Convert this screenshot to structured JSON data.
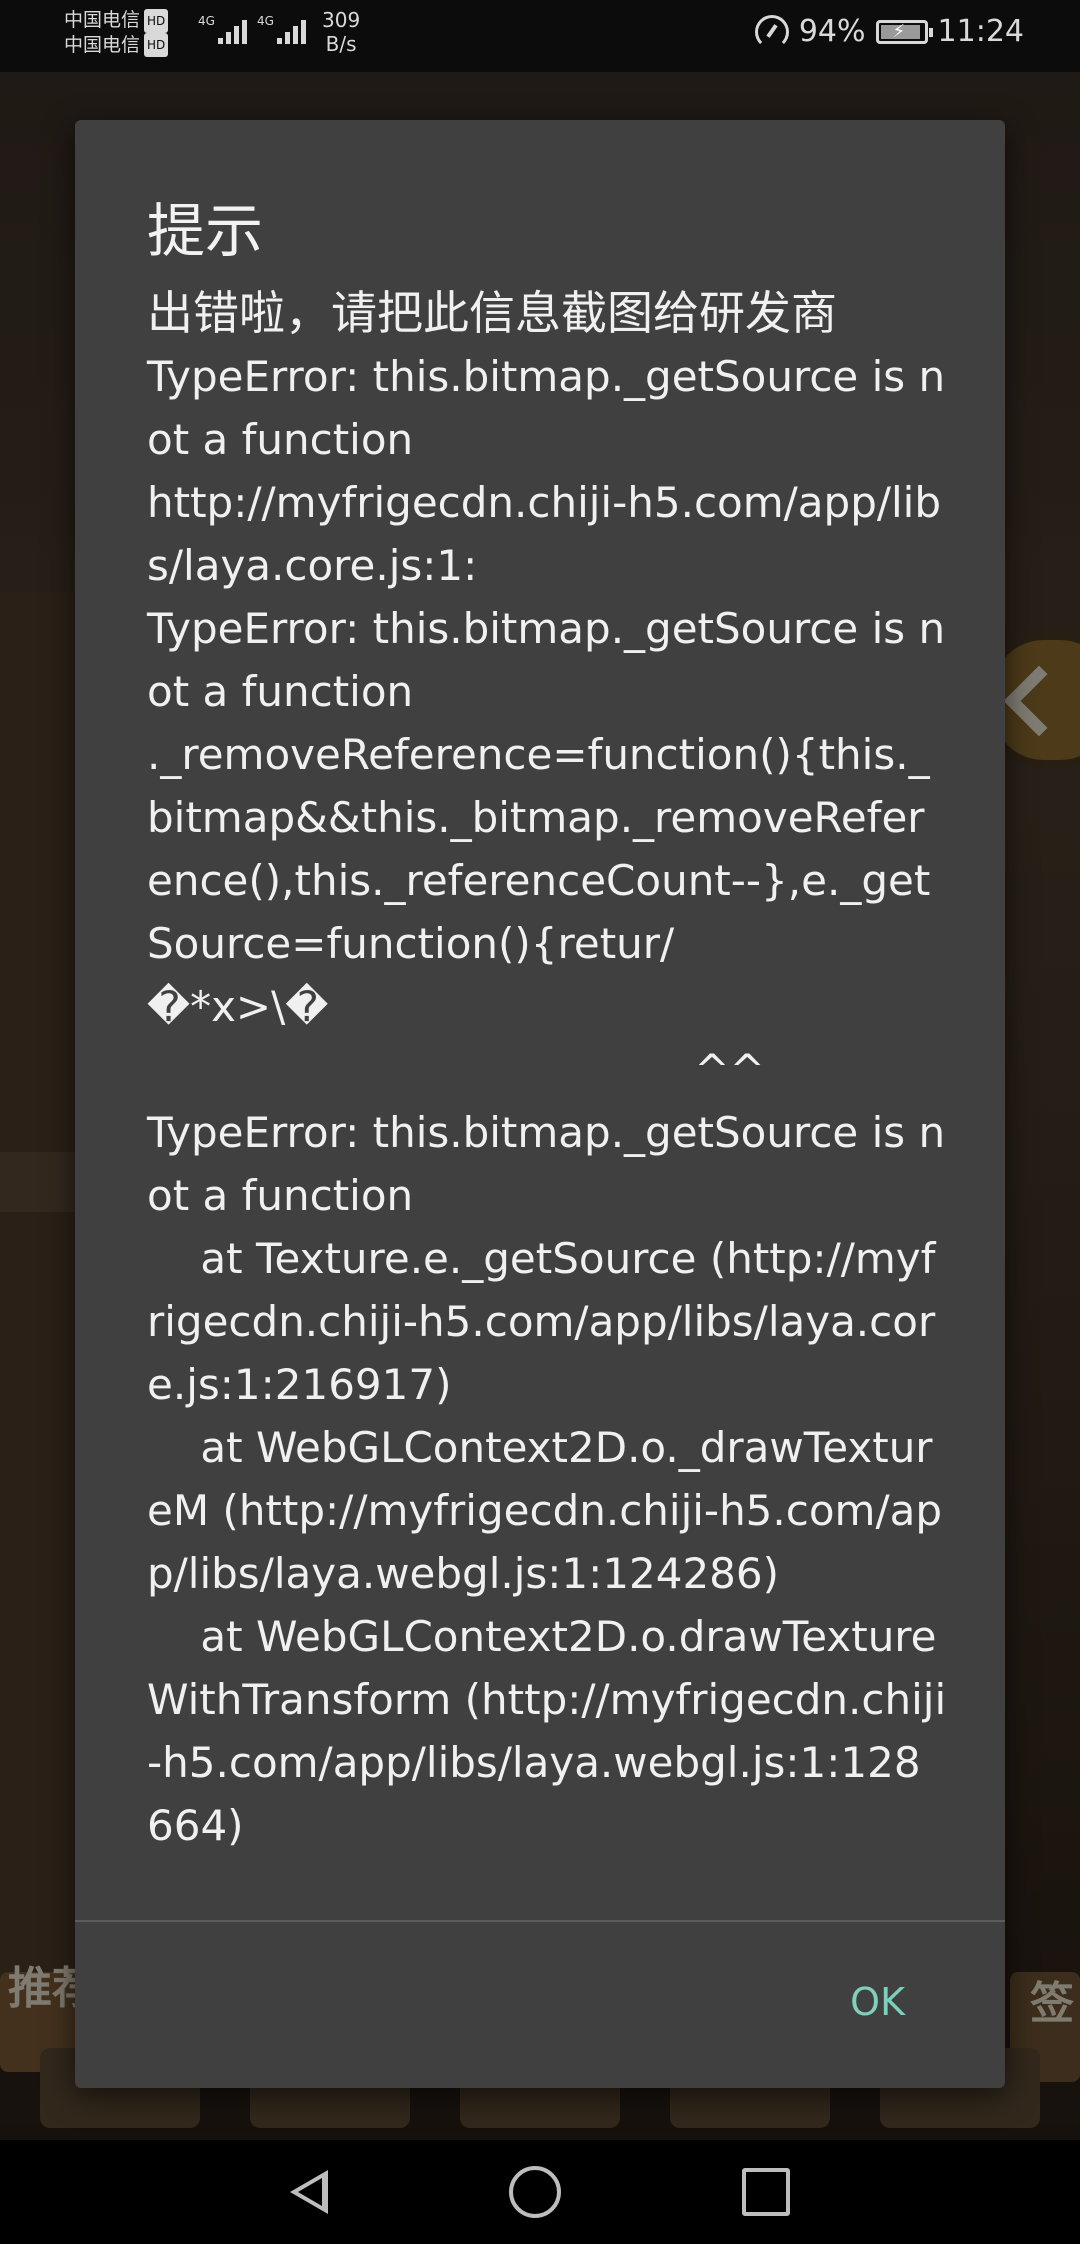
{
  "status_bar": {
    "carrier_1": "中国电信",
    "carrier_2": "中国电信",
    "hd_badge": "HD",
    "network_type": "4G",
    "net_speed_value": "309",
    "net_speed_unit": "B/s",
    "battery_percent": "94%",
    "battery_level": 0.94,
    "time": "11:24"
  },
  "background": {
    "left_label": "推荐",
    "right_label": "签"
  },
  "dialog": {
    "title": "提示",
    "heading": "出错啦，请把此信息截图给研发商",
    "body": "TypeError: this.bitmap._getSource is not a function\nhttp://myfrigecdn.chiji-h5.com/app/libs/laya.core.js:1:\nTypeError: this.bitmap._getSource is not a function\n._removeReference=function(){this._bitmap&&this._bitmap._removeReference(),this._referenceCount--},e._getSource=function(){retur/\n�*x>\\�\n                                         ^^\nTypeError: this.bitmap._getSource is not a function\n    at Texture.e._getSource (http://myfrigecdn.chiji-h5.com/app/libs/laya.core.js:1:216917)\n    at WebGLContext2D.o._drawTextureM (http://myfrigecdn.chiji-h5.com/app/libs/laya.webgl.js:1:124286)\n    at WebGLContext2D.o.drawTextureWithTransform (http://myfrigecdn.chiji-h5.com/app/libs/laya.webgl.js:1:128664)",
    "ok_label": "OK",
    "ok_color": "#7fcfbd"
  },
  "nav_bar": {
    "back_icon": "triangle-back-icon",
    "home_icon": "circle-home-icon",
    "recents_icon": "square-recents-icon"
  }
}
